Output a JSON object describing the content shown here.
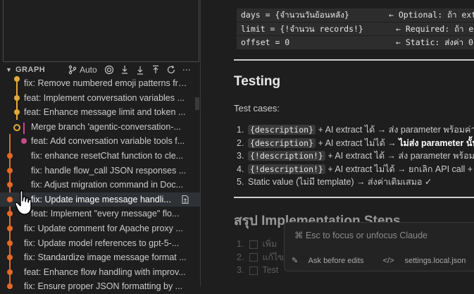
{
  "graph": {
    "title": "GRAPH",
    "auto_label": "Auto",
    "commits": [
      "fix: Remove numbered emoji patterns fro...",
      "feat: Implement conversation variables ...",
      "feat: Enhance message limit and token ...",
      "Merge branch 'agentic-conversation-...",
      "feat: Add conversation variable tools f...",
      "fix: enhance resetChat function to cle...",
      "fix: handle flow_call JSON responses ...",
      "fix: Adjust migration command in Doc...",
      "fix: Update image message handli...",
      "feat: Implement \"every message\" flo...",
      "fix: Update comment for Apache proxy ...",
      "fix: Update model references to gpt-5-...",
      "fix: Standardize image message format ...",
      "feat: Enhance flow handling with improv...",
      "fix: Ensure proper JSON formatting by ..."
    ]
  },
  "doc": {
    "code_rows": [
      {
        "left": "days   = {จำนวนวันย้อนหลัง}",
        "right": "← Optional: ถ้า ext"
      },
      {
        "left": "limit  = {!จำนวน records!}",
        "right": "← Required: ถ้า ex"
      },
      {
        "left": "offset = 0",
        "right": "← Static: ส่งค่า 0"
      }
    ],
    "testing_heading": "Testing",
    "test_cases_label": "Test cases:",
    "cases": [
      {
        "num": "1.",
        "code": "{description}",
        "pre": " + AI extract ได้ → ส่ง parameter พร้อมค่าที่"
      },
      {
        "num": "2.",
        "code": "{description}",
        "pre": " + AI extract ไม่ได้ → ",
        "bold": "ไม่ส่ง parameter นั้น"
      },
      {
        "num": "3.",
        "code": "{!description!}",
        "pre": " + AI extract ได้ → ส่ง parameter พร้อมค"
      },
      {
        "num": "4.",
        "code": "{!description!}",
        "pre": " + AI extract ไม่ได้ → ยกเลิก API call + "
      },
      {
        "num": "5.",
        "text": "Static value (ไม่มี template) → ส่งค่าเดิมเสมอ ✓"
      }
    ],
    "impl_heading": "สรุป Implementation Steps",
    "steps": [
      "1.",
      "เพิ่ม",
      "2.",
      "แก้ไข",
      "3.",
      "Test"
    ]
  },
  "claude_input": {
    "placeholder": "⌘ Esc to focus or unfocus Claude",
    "ask_label": "Ask before edits",
    "file_label": "settings.local.json"
  }
}
